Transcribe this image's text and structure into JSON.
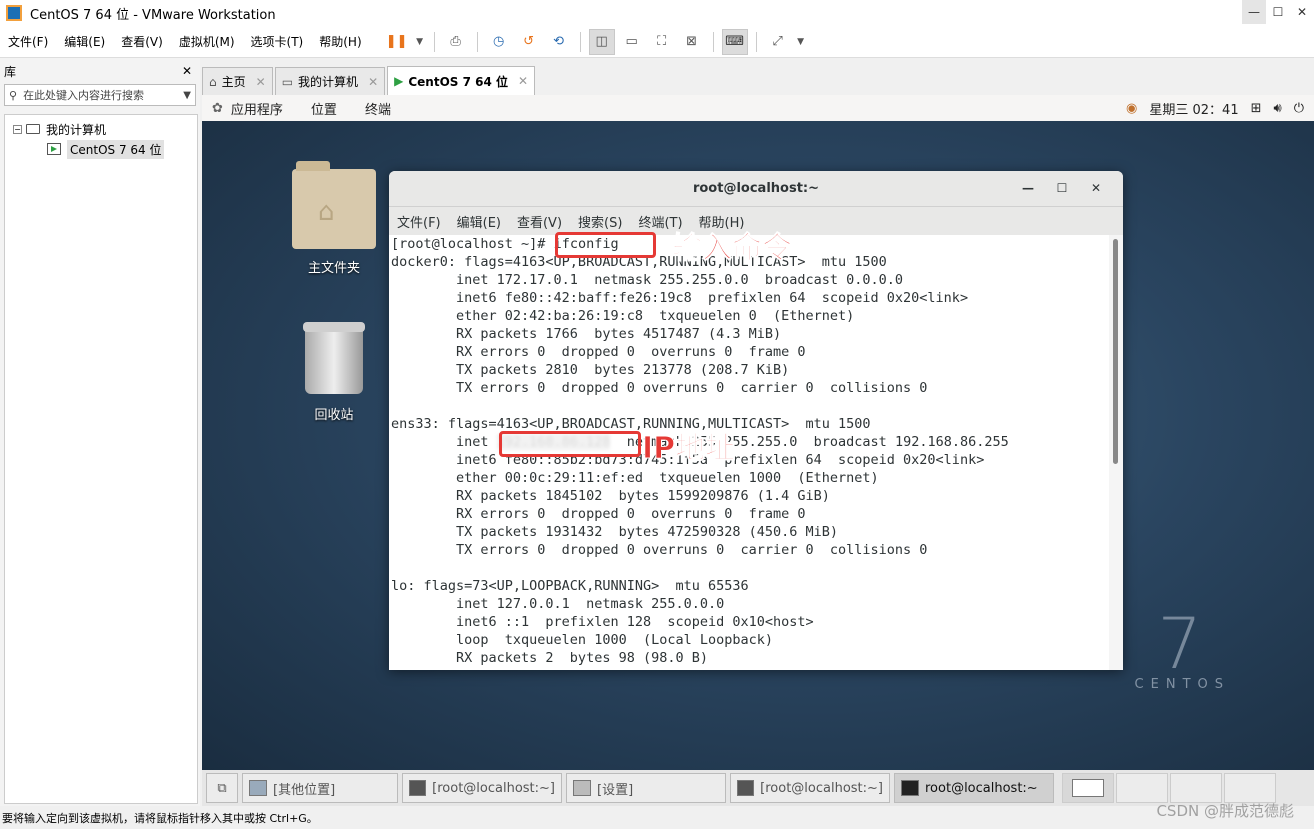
{
  "window": {
    "title": "CentOS 7 64 位 - VMware Workstation"
  },
  "menubar": {
    "items": [
      "文件(F)",
      "编辑(E)",
      "查看(V)",
      "虚拟机(M)",
      "选项卡(T)",
      "帮助(H)"
    ]
  },
  "library": {
    "title": "库",
    "search_placeholder": "在此处键入内容进行搜索",
    "tree": {
      "root": "我的计算机",
      "child": "CentOS 7 64 位"
    }
  },
  "tabs": [
    {
      "label": "主页"
    },
    {
      "label": "我的计算机"
    },
    {
      "label": "CentOS 7 64 位"
    }
  ],
  "gnome": {
    "menus": [
      "应用程序",
      "位置",
      "终端"
    ],
    "clock": "星期三 02：41"
  },
  "desktop": {
    "folder_label": "主文件夹",
    "trash_label": "回收站",
    "brand_number": "7",
    "brand_word": "CENTOS"
  },
  "terminal": {
    "title": "root@localhost:~",
    "menu": [
      "文件(F)",
      "编辑(E)",
      "查看(V)",
      "搜索(S)",
      "终端(T)",
      "帮助(H)"
    ],
    "prompt": "[root@localhost ~]# ",
    "command": "ifconfig",
    "lines_before_ip": [
      "docker0: flags=4163<UP,BROADCAST,RUNNING,MULTICAST>  mtu 1500",
      "        inet 172.17.0.1  netmask 255.255.0.0  broadcast 0.0.0.0",
      "        inet6 fe80::42:baff:fe26:19c8  prefixlen 64  scopeid 0x20<link>",
      "        ether 02:42:ba:26:19:c8  txqueuelen 0  (Ethernet)",
      "        RX packets 1766  bytes 4517487 (4.3 MiB)",
      "        RX errors 0  dropped 0  overruns 0  frame 0",
      "        TX packets 2810  bytes 213778 (208.7 KiB)",
      "        TX errors 0  dropped 0 overruns 0  carrier 0  collisions 0",
      "",
      "ens33: flags=4163<UP,BROADCAST,RUNNING,MULTICAST>  mtu 1500"
    ],
    "ip_line_prefix": "        inet ",
    "ip_hidden": "192.168.86.128",
    "ip_line_suffix": "  netmask 255.255.255.0  broadcast 192.168.86.255",
    "lines_after_ip": [
      "        inet6 fe80::85b2:bd73:d745:1f5a  prefixlen 64  scopeid 0x20<link>",
      "        ether 00:0c:29:11:ef:ed  txqueuelen 1000  (Ethernet)",
      "        RX packets 1845102  bytes 1599209876 (1.4 GiB)",
      "        RX errors 0  dropped 0  overruns 0  frame 0",
      "        TX packets 1931432  bytes 472590328 (450.6 MiB)",
      "        TX errors 0  dropped 0 overruns 0  carrier 0  collisions 0",
      "",
      "lo: flags=73<UP,LOOPBACK,RUNNING>  mtu 65536",
      "        inet 127.0.0.1  netmask 255.0.0.0",
      "        inet6 ::1  prefixlen 128  scopeid 0x10<host>",
      "        loop  txqueuelen 1000  (Local Loopback)",
      "        RX packets 2  bytes 98 (98.0 B)"
    ]
  },
  "annotations": {
    "command": "输入命令",
    "ip": "IP地址"
  },
  "taskbar": {
    "items": [
      "[其他位置]",
      "[root@localhost:~]",
      "[设置]",
      "[root@localhost:~]",
      "root@localhost:~"
    ]
  },
  "statusbar": {
    "text": "要将输入定向到该虚拟机，请将鼠标指针移入其中或按 Ctrl+G。"
  },
  "watermark": "CSDN @胖成范德彪"
}
